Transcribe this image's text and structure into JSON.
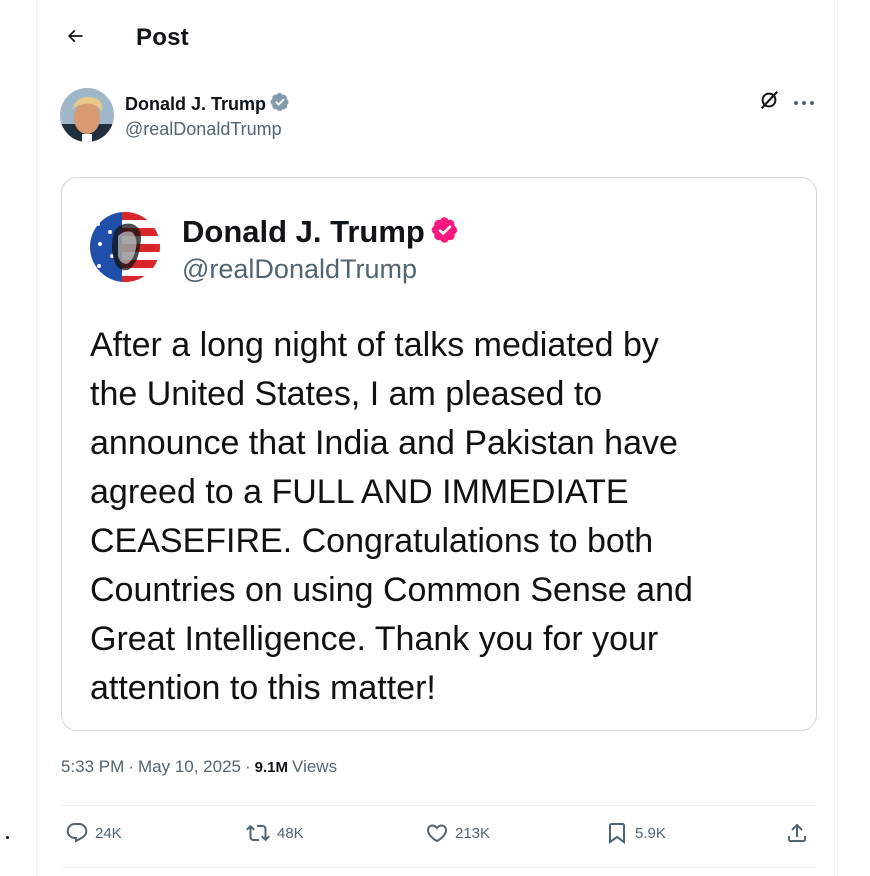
{
  "header": {
    "title": "Post",
    "back_icon": "arrow-left-icon"
  },
  "author": {
    "name": "Donald J. Trump",
    "handle": "@realDonaldTrump",
    "verified_color": "#829aab"
  },
  "embedded_post": {
    "name": "Donald J. Trump",
    "handle": "@realDonaldTrump",
    "verified_color": "#f91880",
    "text": "After a long night of talks mediated by\nthe United States, I am pleased to\nannounce that India and Pakistan have\nagreed to a FULL AND IMMEDIATE\nCEASEFIRE. Congratulations to both\nCountries on using Common Sense and\nGreat Intelligence. Thank you for your\nattention to this matter!"
  },
  "meta": {
    "time": "5:33 PM",
    "date": "May 10, 2025",
    "views_count": "9.1M",
    "views_label": "Views",
    "separator": "·"
  },
  "actions": {
    "replies": "24K",
    "reposts": "48K",
    "likes": "213K",
    "bookmarks": "5.9K"
  },
  "colors": {
    "text_primary": "#0f1419",
    "text_secondary": "#536471",
    "border": "#cfd9de"
  }
}
